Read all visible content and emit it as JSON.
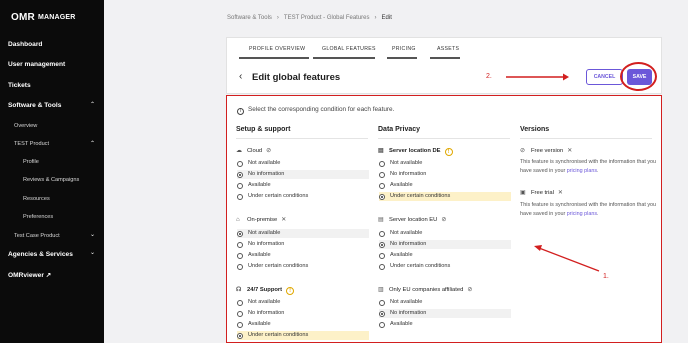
{
  "sidebar": {
    "logo_brand": "OMR",
    "logo_product": "MANAGER",
    "items": [
      {
        "label": "Dashboard"
      },
      {
        "label": "User management"
      },
      {
        "label": "Tickets"
      },
      {
        "label": "Software & Tools"
      },
      {
        "label": "Overview"
      },
      {
        "label": "TEST Product"
      },
      {
        "label": "Profile"
      },
      {
        "label": "Reviews & Campaigns"
      },
      {
        "label": "Resources"
      },
      {
        "label": "Preferences"
      },
      {
        "label": "Test Case Product"
      },
      {
        "label": "Agencies & Services"
      },
      {
        "label": "OMRviewer ↗"
      }
    ]
  },
  "breadcrumb": [
    "Software & Tools",
    "TEST Product - Global Features",
    "Edit"
  ],
  "tabs": [
    "PROFILE OVERVIEW",
    "GLOBAL FEATURES",
    "PRICING",
    "ASSETS"
  ],
  "page_title": "Edit global features",
  "annotations": {
    "step1": "1.",
    "step2": "2.",
    "accent": "#d21f1f"
  },
  "buttons": {
    "cancel": "CANCEL",
    "save": "SAVE",
    "accent": "#6b57d9"
  },
  "hint": "Select the corresponding condition for each feature.",
  "columns": {
    "setup": "Setup & support",
    "privacy": "Data Privacy",
    "versions": "Versions"
  },
  "options": [
    "Not available",
    "No information",
    "Available",
    "Under certain conditions"
  ],
  "setup_features": [
    {
      "name": "Cloud",
      "selected": "No information"
    },
    {
      "name": "On-premise",
      "selected": "Not available"
    },
    {
      "name": "24/7 Support",
      "selected": "Under certain conditions"
    }
  ],
  "privacy_features": [
    {
      "name": "Server location DE",
      "selected": "Under certain conditions"
    },
    {
      "name": "Server location EU",
      "selected": "No information"
    },
    {
      "name": "Only EU companies affiliated",
      "selected": "No information"
    }
  ],
  "versions": [
    {
      "name": "Free version",
      "text": "This feature is synchronised with the information that you have saved in your",
      "link": "pricing plans",
      "end": "."
    },
    {
      "name": "Free trial",
      "text": "This feature is synchronised with the information that you have saved in your",
      "link": "pricing plans",
      "end": "."
    }
  ]
}
